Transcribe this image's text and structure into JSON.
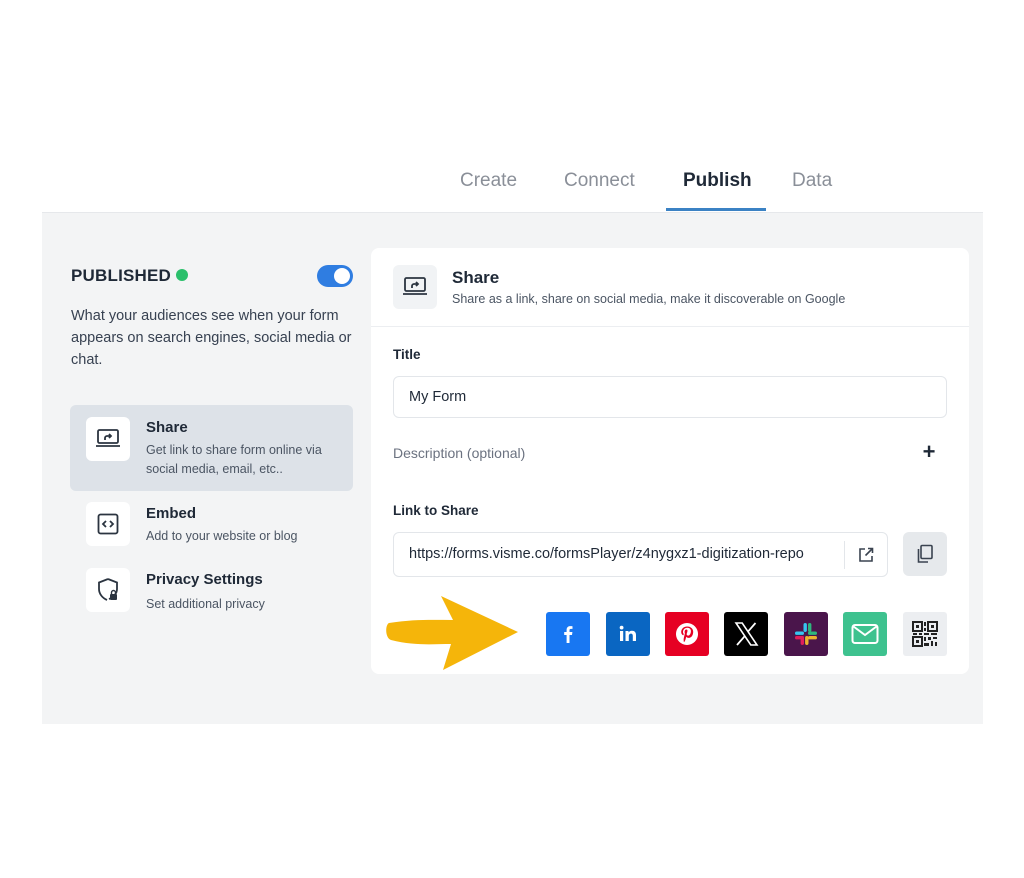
{
  "tabs": [
    {
      "label": "Create"
    },
    {
      "label": "Connect"
    },
    {
      "label": "Publish"
    },
    {
      "label": "Data"
    }
  ],
  "status": {
    "label": "PUBLISHED",
    "dot_color": "#2bbf6b",
    "toggle_on": true,
    "description": "What your audiences see when your form appears on search engines, social media or chat."
  },
  "sidebar": {
    "items": [
      {
        "title": "Share",
        "subtitle": "Get link to share form online via social media, email, etc..",
        "icon": "share-screen-icon",
        "active": true
      },
      {
        "title": "Embed",
        "subtitle": "Add to your website or blog",
        "icon": "code-icon",
        "active": false
      },
      {
        "title": "Privacy Settings",
        "subtitle": "Set additional privacy",
        "icon": "shield-lock-icon",
        "active": false
      }
    ]
  },
  "panel": {
    "title": "Share",
    "subtitle": "Share as a link, share on social media, make it discoverable on Google",
    "title_field": {
      "label": "Title",
      "value": "My Form"
    },
    "description": {
      "label": "Description (optional)",
      "add": "+"
    },
    "link": {
      "label": "Link to Share",
      "value": "https://forms.visme.co/formsPlayer/z4nygxz1-digitization-repo"
    },
    "social": [
      {
        "name": "facebook",
        "color": "#1877f2"
      },
      {
        "name": "linkedin",
        "color": "#0a66c2"
      },
      {
        "name": "pinterest",
        "color": "#e60023"
      },
      {
        "name": "x",
        "color": "#000000"
      },
      {
        "name": "slack",
        "color": "#4a154b"
      },
      {
        "name": "email",
        "color": "#3ec28f"
      },
      {
        "name": "qr-code",
        "color": "#eceef1"
      }
    ]
  },
  "colors": {
    "accent": "#3b82c4",
    "toggle": "#2f7de1",
    "arrow": "#f5b50a"
  }
}
